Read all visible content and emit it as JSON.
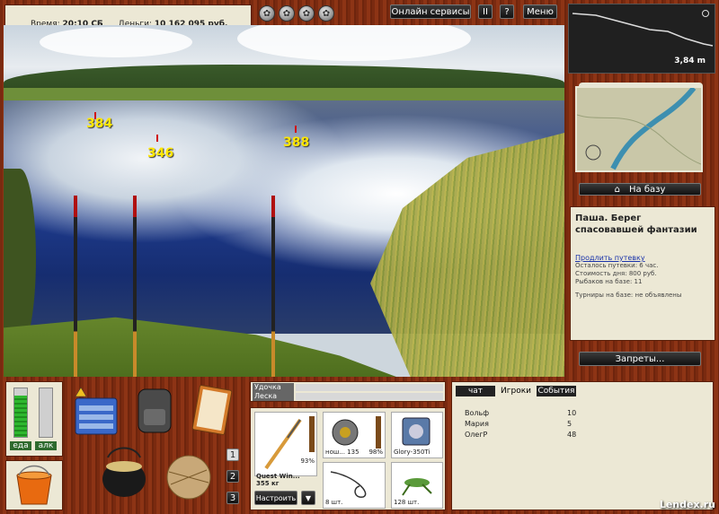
{
  "status": {
    "time_label": "Время:",
    "time_value": "20:10 СБ",
    "money_label": "Деньги:",
    "money_value": "10 162 095 руб."
  },
  "header": {
    "online_services": "Онлайн сервисы",
    "pause": "II",
    "help": "?",
    "menu": "Меню"
  },
  "scene": {
    "depths": [
      "384",
      "346",
      "388"
    ]
  },
  "minimap": {
    "depth": "3,84 m"
  },
  "base_button": "На базу",
  "info": {
    "title": "Паша. Берег спасовавшей фантазии",
    "extend_link": "Продлить путевку",
    "remaining": "Осталось путевки: 6 час.",
    "cost": "Стоимость дня: 800 руб.",
    "fishers": "Рыбаков на базе: 11",
    "tournaments": "Турниры на базе: не объявлены"
  },
  "bans_button": "Запреты...",
  "meters": {
    "food_label": "еда",
    "alcohol_label": "алк",
    "food_level": 0.85,
    "alcohol_level": 0.0
  },
  "rod_sets": [
    "1",
    "2",
    "3"
  ],
  "tackle": {
    "rod_label": "Удочка",
    "line_label": "Леска"
  },
  "equipment": {
    "rod_name": "Quest Win...",
    "rod_weight": "355 кг",
    "rod_pct": "93%",
    "reel_info": "нош... 135",
    "reel_pct": "98%",
    "lure_name": "Glory-350Ti",
    "hook_count": "8 шт.",
    "bait_count": "128 шт.",
    "setup_button": "Настроить",
    "dropdown": "▼"
  },
  "players_panel": {
    "tabs": [
      "чат",
      "Игроки",
      "События"
    ],
    "players": [
      {
        "name": "Вольф",
        "value": "10"
      },
      {
        "name": "Мария",
        "value": "5"
      },
      {
        "name": "ОлегР",
        "value": "48"
      }
    ]
  },
  "watermark": "Lendex.ru"
}
